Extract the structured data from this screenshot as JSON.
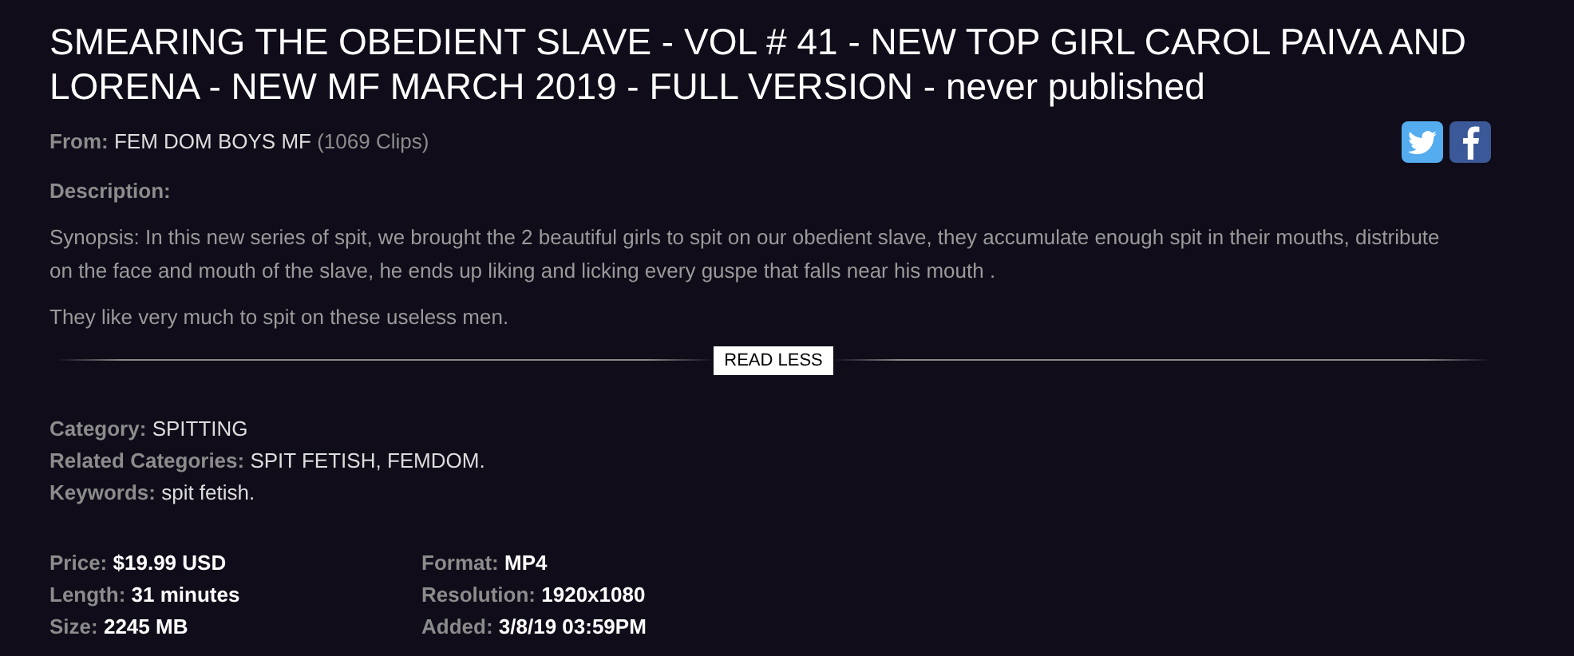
{
  "title": "SMEARING THE OBEDIENT SLAVE - VOL # 41 - NEW TOP GIRL CAROL PAIVA AND LORENA - NEW MF MARCH 2019 - FULL VERSION - never published",
  "from": {
    "label": "From:",
    "studio": "FEM DOM BOYS MF",
    "count": "(1069 Clips)"
  },
  "share": [
    {
      "kind": "twitter"
    },
    {
      "kind": "facebook"
    }
  ],
  "description": {
    "label": "Description:",
    "paragraphs": [
      "Synopsis: In this new series of spit, we brought the 2 beautiful girls to spit on our obedient slave, they accumulate enough spit in their mouths, distribute on the face and mouth of the slave, he ends up liking and licking every guspe that falls near his mouth .",
      "They like very much to spit on these useless men."
    ]
  },
  "toggle_button": "READ LESS",
  "categories": [
    {
      "label": "Category:",
      "value": "SPITTING"
    },
    {
      "label": "Related Categories:",
      "value": "SPIT FETISH, FEMDOM."
    },
    {
      "label": "Keywords:",
      "value": "spit fetish."
    }
  ],
  "details": [
    {
      "label": "Price:",
      "value": "$19.99 USD"
    },
    {
      "label": "Format:",
      "value": "MP4"
    },
    {
      "label": "Length:",
      "value": "31 minutes"
    },
    {
      "label": "Resolution:",
      "value": "1920x1080"
    },
    {
      "label": "Size:",
      "value": "2245 MB"
    },
    {
      "label": "Added:",
      "value": "3/8/19 03:59PM"
    }
  ]
}
